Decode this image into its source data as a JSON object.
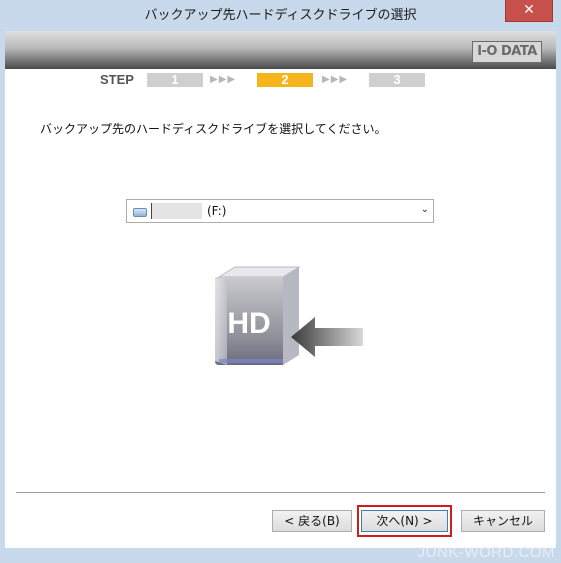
{
  "window": {
    "title": "バックアップ先ハードディスクドライブの選択",
    "close_glyph": "✕"
  },
  "banner": {
    "logo_text": "I-O DATA"
  },
  "steps": {
    "label": "STEP",
    "items": [
      {
        "number": "1",
        "active": false
      },
      {
        "number": "2",
        "active": true
      },
      {
        "number": "3",
        "active": false
      }
    ],
    "arrows": "▶▶▶",
    "active_color": "#f4b41a",
    "inactive_color": "#cfcfcf"
  },
  "main": {
    "instruction": "バックアップ先のハードディスクドライブを選択してください。",
    "drive_select": {
      "selected_value": "(F:)",
      "icon": "usb-drive-icon"
    },
    "illustration": {
      "icon": "hard-drive-icon",
      "text": "HD"
    }
  },
  "buttons": {
    "back": "< 戻る(B)",
    "next": "次へ(N) >",
    "cancel": "キャンセル"
  },
  "watermark": "JUNK-WORD.COM"
}
